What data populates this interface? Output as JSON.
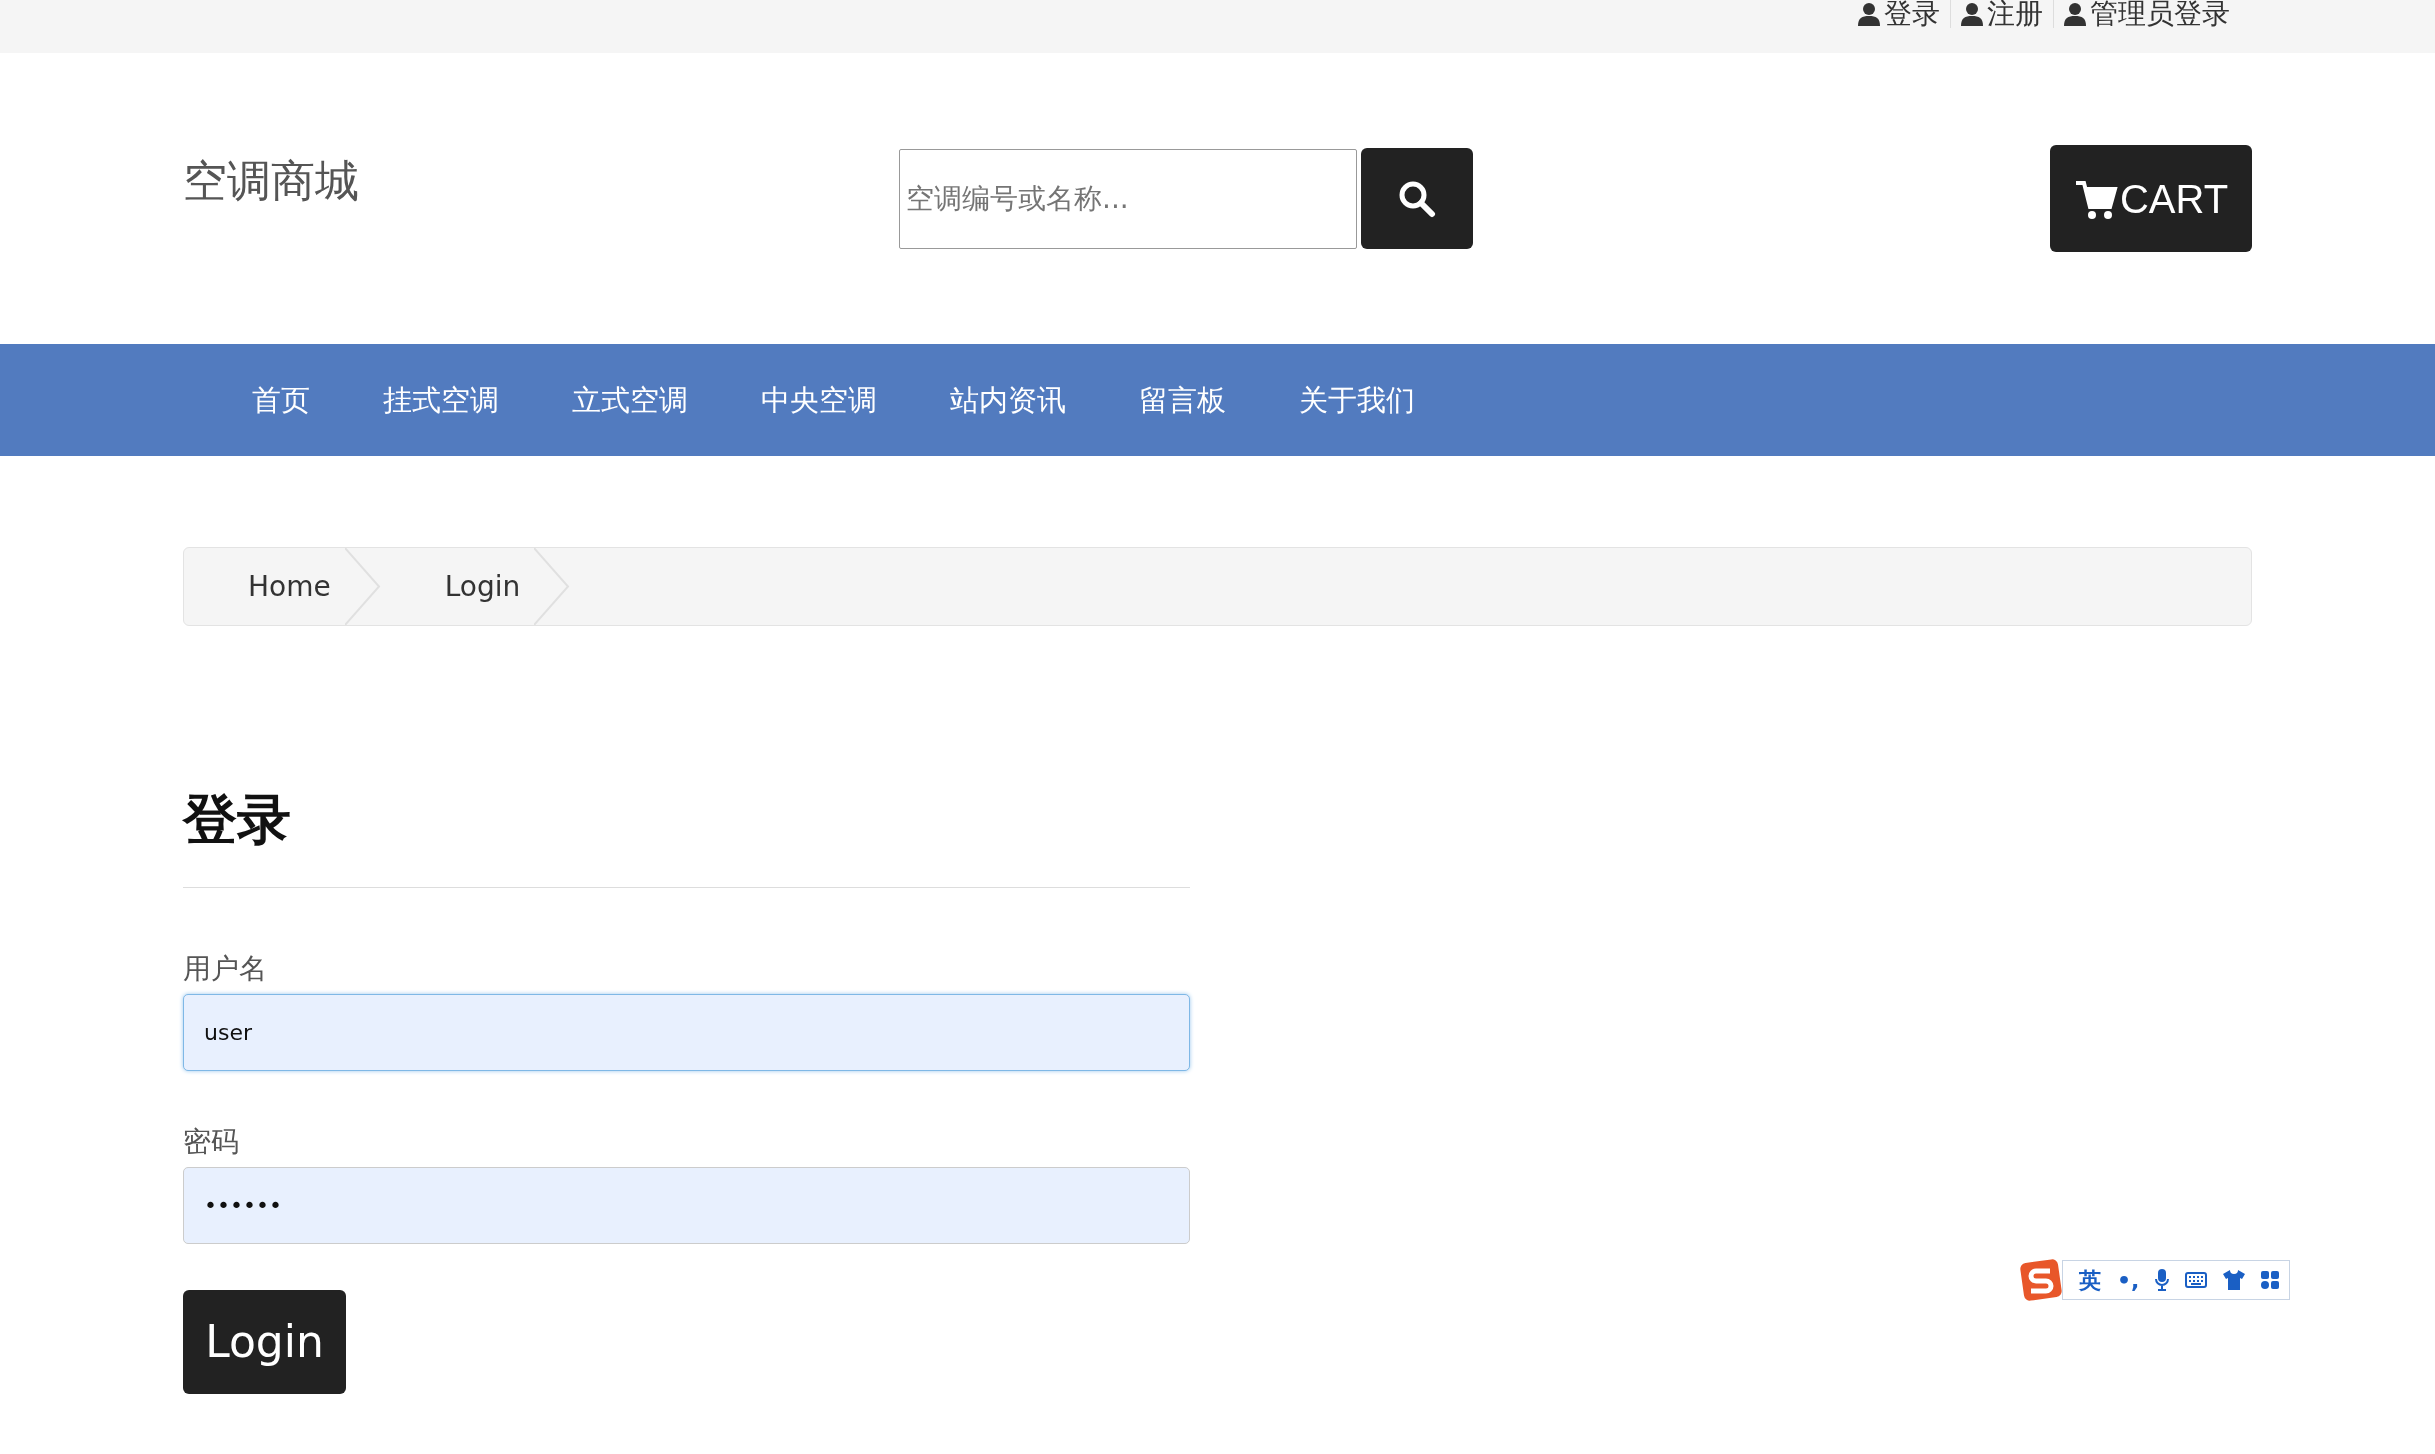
{
  "top_links": [
    {
      "label": "登录"
    },
    {
      "label": "注册"
    },
    {
      "label": "管理员登录"
    }
  ],
  "header": {
    "site_title": "空调商城",
    "search": {
      "placeholder": "空调编号或名称..."
    },
    "cart_label": "CART"
  },
  "nav": [
    {
      "label": "首页"
    },
    {
      "label": "挂式空调"
    },
    {
      "label": "立式空调"
    },
    {
      "label": "中央空调"
    },
    {
      "label": "站内资讯"
    },
    {
      "label": "留言板"
    },
    {
      "label": "关于我们"
    }
  ],
  "breadcrumb": [
    {
      "label": "Home"
    },
    {
      "label": "Login"
    }
  ],
  "form": {
    "heading": "登录",
    "fields": [
      {
        "label": "用户名",
        "value": "user",
        "focused": true
      },
      {
        "label": "密码",
        "value": "••••••",
        "focused": false
      }
    ],
    "submit": "Login"
  },
  "ime_toolbar": {
    "mode": "英",
    "punct": "•,"
  }
}
